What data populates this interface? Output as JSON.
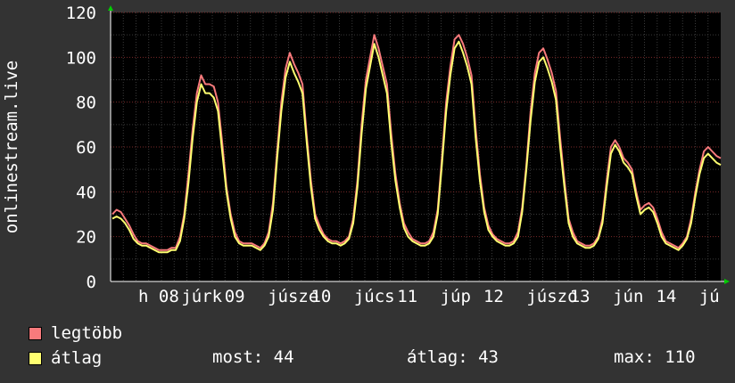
{
  "ylabel": "onlinestream.live",
  "legend": [
    {
      "name": "legtöbb",
      "color": "#f87a7c"
    },
    {
      "name": "átlag",
      "color": "#ffff70"
    }
  ],
  "stats": {
    "now_label": "most: 44",
    "avg_label": "átlag: 43",
    "max_label": "max: 110"
  },
  "chart_data": {
    "type": "line",
    "ylim": [
      0,
      120
    ],
    "yticks": [
      0,
      20,
      40,
      60,
      80,
      100,
      120
    ],
    "grid": true,
    "xtick_labels": [
      "h 08",
      "júrk",
      "09",
      "júsze",
      "10",
      "júcs",
      "11",
      "júp",
      "12",
      "júszo",
      "13",
      "jún",
      "14",
      "jú"
    ],
    "series": [
      {
        "name": "legtöbb",
        "color": "#f87a7c",
        "values": [
          30,
          32,
          31,
          28,
          25,
          21,
          18,
          17,
          17,
          16,
          15,
          14,
          14,
          14,
          15,
          15,
          20,
          30,
          48,
          68,
          84,
          92,
          88,
          88,
          87,
          80,
          62,
          42,
          30,
          22,
          18,
          17,
          17,
          17,
          16,
          15,
          17,
          22,
          35,
          58,
          80,
          95,
          102,
          97,
          93,
          88,
          65,
          45,
          30,
          25,
          21,
          19,
          18,
          18,
          17,
          18,
          20,
          28,
          45,
          70,
          90,
          100,
          110,
          104,
          96,
          88,
          66,
          48,
          35,
          26,
          22,
          19,
          18,
          17,
          17,
          18,
          22,
          32,
          55,
          80,
          96,
          108,
          110,
          106,
          100,
          92,
          68,
          48,
          33,
          25,
          21,
          19,
          18,
          17,
          17,
          18,
          22,
          33,
          52,
          76,
          93,
          102,
          104,
          99,
          93,
          85,
          64,
          45,
          28,
          22,
          18,
          17,
          16,
          16,
          17,
          20,
          28,
          45,
          60,
          63,
          60,
          55,
          53,
          50,
          40,
          32,
          34,
          35,
          33,
          28,
          22,
          18,
          17,
          16,
          15,
          17,
          20,
          28,
          40,
          50,
          58,
          60,
          58,
          56,
          55
        ]
      },
      {
        "name": "átlag",
        "color": "#ffff70",
        "values": [
          28,
          29,
          28,
          26,
          23,
          19,
          17,
          16,
          16,
          15,
          14,
          13,
          13,
          13,
          14,
          14,
          18,
          28,
          44,
          64,
          80,
          88,
          84,
          84,
          82,
          76,
          58,
          40,
          28,
          20,
          17,
          16,
          16,
          16,
          15,
          14,
          16,
          20,
          32,
          55,
          76,
          91,
          98,
          93,
          89,
          84,
          62,
          42,
          28,
          23,
          20,
          18,
          17,
          17,
          16,
          17,
          19,
          26,
          42,
          66,
          86,
          96,
          106,
          100,
          92,
          84,
          62,
          45,
          33,
          24,
          20,
          18,
          17,
          16,
          16,
          17,
          20,
          30,
          52,
          76,
          92,
          104,
          107,
          102,
          96,
          88,
          64,
          45,
          31,
          23,
          20,
          18,
          17,
          16,
          16,
          17,
          20,
          31,
          50,
          72,
          89,
          98,
          100,
          95,
          89,
          81,
          60,
          42,
          26,
          20,
          17,
          16,
          15,
          15,
          16,
          19,
          26,
          42,
          57,
          61,
          58,
          53,
          51,
          48,
          38,
          30,
          32,
          33,
          31,
          26,
          20,
          17,
          16,
          15,
          14,
          16,
          19,
          26,
          38,
          48,
          55,
          57,
          55,
          53,
          52
        ]
      }
    ]
  }
}
